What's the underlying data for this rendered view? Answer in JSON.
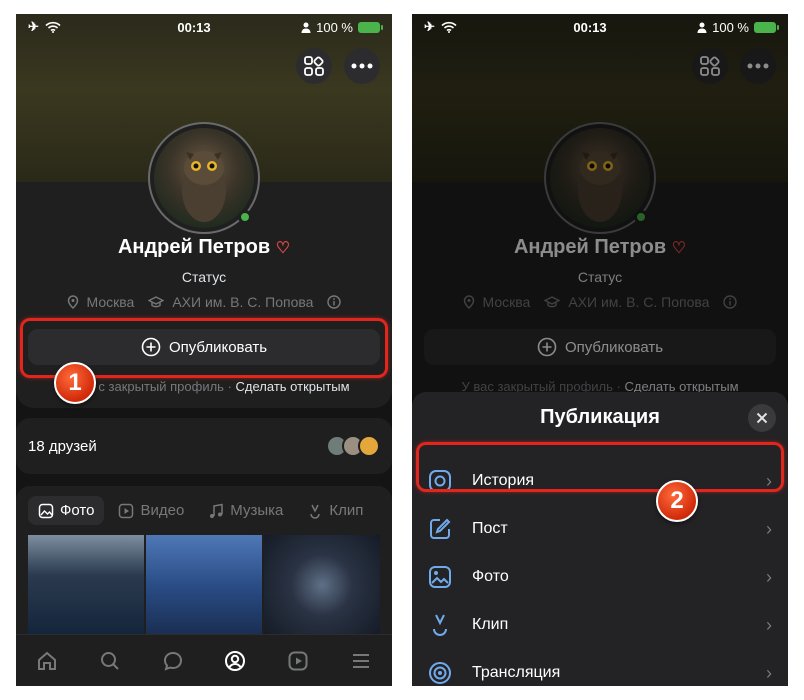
{
  "status_bar": {
    "time": "00:13",
    "battery": "100 %"
  },
  "profile": {
    "name": "Андрей Петров",
    "status": "Статус",
    "city": "Москва",
    "university": "АХИ им. В. С. Попова",
    "publish_label": "Опубликовать",
    "closed_text": "У вас закрытый профиль ·",
    "closed_text_short": "с закрытый профиль ·",
    "make_open": "Сделать открытым"
  },
  "friends": {
    "label": "18 друзей"
  },
  "media_tabs": [
    {
      "label": "Фото"
    },
    {
      "label": "Видео"
    },
    {
      "label": "Музыка"
    },
    {
      "label": "Клип"
    }
  ],
  "sheet": {
    "title": "Публикация",
    "items": [
      {
        "label": "История",
        "icon": "story-icon"
      },
      {
        "label": "Пост",
        "icon": "post-icon"
      },
      {
        "label": "Фото",
        "icon": "photo-icon"
      },
      {
        "label": "Клип",
        "icon": "clip-icon"
      },
      {
        "label": "Трансляция",
        "icon": "broadcast-icon"
      }
    ]
  },
  "annotations": {
    "step1": "1",
    "step2": "2"
  },
  "colors": {
    "accent": "#e0261d",
    "online": "#4bb34b",
    "sheet_icon": "#71aaeb"
  }
}
